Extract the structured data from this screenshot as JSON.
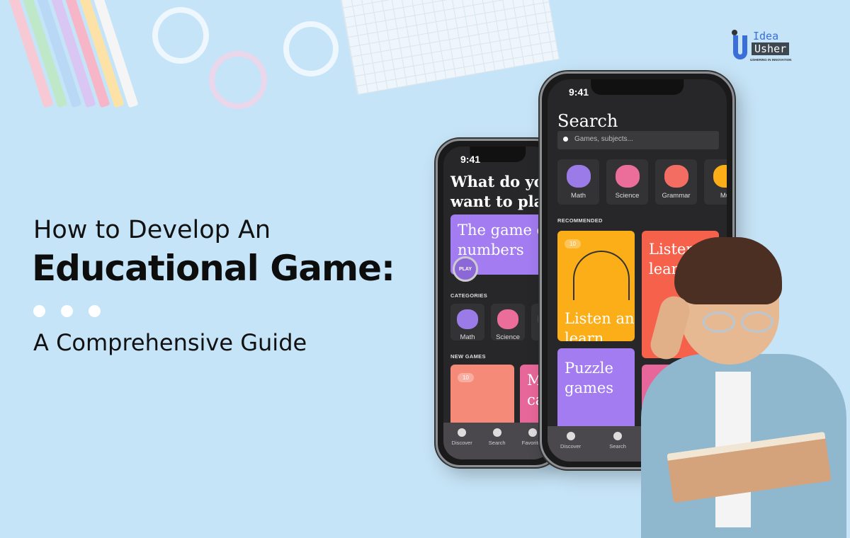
{
  "headline": {
    "line1": "How to Develop An",
    "line2": "Educational Game:",
    "line3": "A Comprehensive Guide"
  },
  "logo": {
    "word1": "Idea",
    "word2": "Usher",
    "tagline": "USHERING IN INNOVATION"
  },
  "colors": {
    "background": "#c6e4f7",
    "logo_blue": "#3a6fd8",
    "screen": "#272729",
    "card_yellow": "#fbae17",
    "card_red": "#f6614c",
    "card_purple": "#a27cf0",
    "card_salmon": "#f58a79",
    "card_pink": "#e8679a"
  },
  "phone_back": {
    "time": "9:41",
    "title": "What do you want to play today?",
    "featured": "The game of six numbers",
    "play": "PLAY",
    "categories_label": "CATEGORIES",
    "categories": [
      "Math",
      "Science",
      "G"
    ],
    "new_games_label": "NEW GAMES",
    "new_game_badge": "10",
    "new_game2": "M ca",
    "tabs": [
      "Discover",
      "Search",
      "Favorites"
    ]
  },
  "phone_front": {
    "time": "9:41",
    "title": "Search",
    "search_placeholder": "Games, subjects...",
    "categories": [
      "Math",
      "Science",
      "Grammar",
      "Mu"
    ],
    "recommended_label": "RECOMMENDED",
    "cards": [
      {
        "title": "Listen and learn",
        "badge": "10"
      },
      {
        "title": "Listen and learn"
      },
      {
        "title": "Puzzle games"
      }
    ],
    "tabs": [
      "Discover",
      "Search"
    ]
  }
}
